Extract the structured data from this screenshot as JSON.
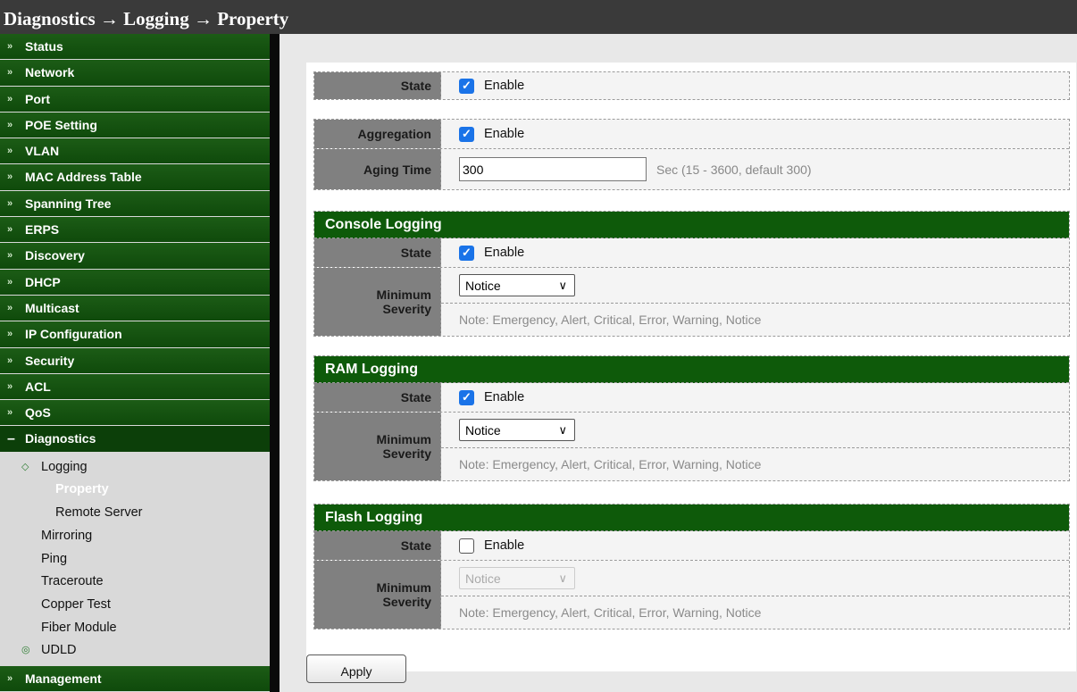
{
  "title": {
    "parts": [
      "Diagnostics",
      "Logging",
      "Property"
    ],
    "sep": " → ",
    "text": "Diagnostics → Logging → Property"
  },
  "sidebar": {
    "items": [
      {
        "label": "Status",
        "icon": "double-chevron-down-icon"
      },
      {
        "label": "Network",
        "icon": "double-chevron-down-icon"
      },
      {
        "label": "Port",
        "icon": "double-chevron-down-icon"
      },
      {
        "label": "POE Setting",
        "icon": "double-chevron-down-icon"
      },
      {
        "label": "VLAN",
        "icon": "double-chevron-down-icon"
      },
      {
        "label": "MAC Address Table",
        "icon": "double-chevron-down-icon"
      },
      {
        "label": "Spanning Tree",
        "icon": "double-chevron-down-icon"
      },
      {
        "label": "ERPS",
        "icon": "double-chevron-down-icon"
      },
      {
        "label": "Discovery",
        "icon": "double-chevron-down-icon"
      },
      {
        "label": "DHCP",
        "icon": "double-chevron-down-icon"
      },
      {
        "label": "Multicast",
        "icon": "double-chevron-down-icon"
      },
      {
        "label": "IP Configuration",
        "icon": "double-chevron-down-icon"
      },
      {
        "label": "Security",
        "icon": "double-chevron-down-icon"
      },
      {
        "label": "ACL",
        "icon": "double-chevron-down-icon"
      },
      {
        "label": "QoS",
        "icon": "double-chevron-down-icon"
      },
      {
        "label": "Diagnostics",
        "icon": "minus-icon"
      }
    ],
    "diagnostics_sub": [
      {
        "label": "Logging",
        "icon": "folder-open-icon"
      },
      {
        "label": "Property",
        "active": true
      },
      {
        "label": "Remote Server"
      },
      {
        "label": "Mirroring"
      },
      {
        "label": "Ping"
      },
      {
        "label": "Traceroute"
      },
      {
        "label": "Copper Test"
      },
      {
        "label": "Fiber Module"
      },
      {
        "label": "UDLD",
        "icon": "folder-closed-icon"
      }
    ],
    "bottom_item": {
      "label": "Management",
      "icon": "double-chevron-down-icon"
    }
  },
  "form": {
    "state": {
      "label": "State",
      "checked": true,
      "option": "Enable"
    },
    "aggregation": {
      "label": "Aggregation",
      "checked": true,
      "option": "Enable"
    },
    "aging_time": {
      "label": "Aging Time",
      "value": "300",
      "hint": "Sec (15 - 3600, default 300)"
    },
    "console_logging": {
      "header": "Console Logging",
      "state_label": "State",
      "checked": true,
      "option": "Enable",
      "severity_label_1": "Minimum",
      "severity_label_2": "Severity",
      "severity": "Notice",
      "note": "Note: Emergency, Alert, Critical, Error, Warning, Notice"
    },
    "ram_logging": {
      "header": "RAM Logging",
      "state_label": "State",
      "checked": true,
      "option": "Enable",
      "severity_label_1": "Minimum",
      "severity_label_2": "Severity",
      "severity": "Notice",
      "note": "Note: Emergency, Alert, Critical, Error, Warning, Notice"
    },
    "flash_logging": {
      "header": "Flash Logging",
      "state_label": "State",
      "checked": false,
      "option": "Enable",
      "severity_label_1": "Minimum",
      "severity_label_2": "Severity",
      "severity": "Notice",
      "severity_disabled": true,
      "note": "Note: Emergency, Alert, Critical, Error, Warning, Notice"
    },
    "apply_label": "Apply"
  },
  "colors": {
    "menu_green": "#0f4a0b",
    "section_header_green": "#0e5a0a",
    "label_gray": "#808080",
    "checkbox_blue": "#1a73e8",
    "titlebar": "#3a3a3a"
  }
}
